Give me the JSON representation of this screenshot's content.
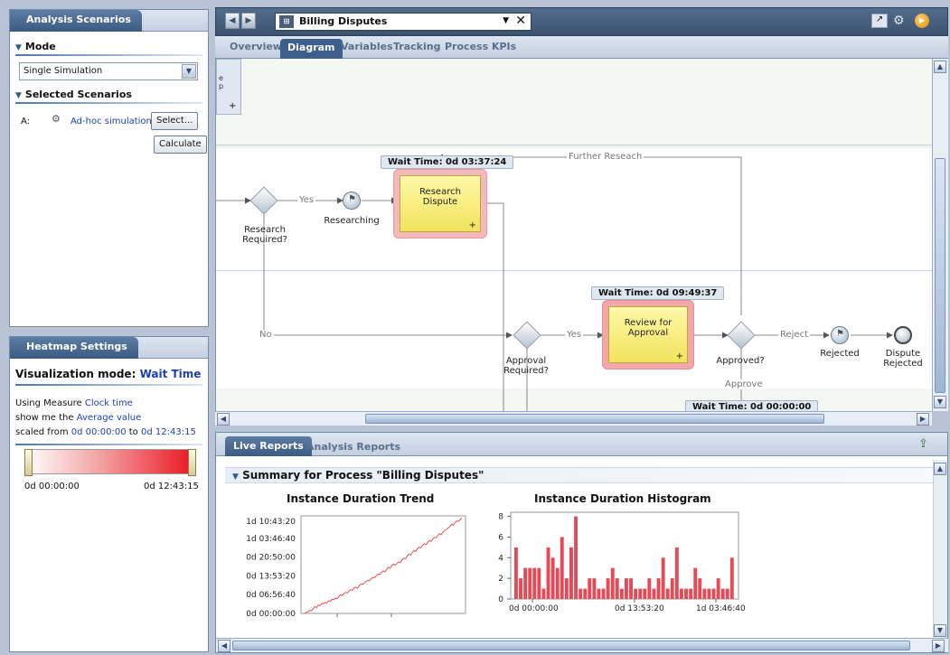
{
  "left_panel": {
    "tab_label": "Analysis Scenarios",
    "mode_title": "Mode",
    "mode_value": "Single Simulation",
    "selected_title": "Selected Scenarios",
    "scenario_letter": "A:",
    "scenario_name": "Ad-hoc simulation",
    "select_button": "Select...",
    "calculate_button": "Calculate"
  },
  "heatmap": {
    "tab_label": "Heatmap Settings",
    "mode_label": "Visualization mode:",
    "mode_value": "Wait Time",
    "measure_prefix": "Using Measure",
    "measure_value": "Clock time",
    "show_prefix": "show me the",
    "show_value": "Average value",
    "scaled_prefix": "scaled from",
    "scaled_from": "0d 00:00:00",
    "scaled_to_word": "to",
    "scaled_to": "0d 12:43:15",
    "legend_min": "0d 00:00:00",
    "legend_max": "0d 12:43:15",
    "colors": {
      "start": "#ffffff",
      "end": "#e8141f"
    }
  },
  "topbar": {
    "process_title": "Billing Disputes",
    "icons": [
      "chart-icon",
      "gear-icon",
      "play-icon"
    ]
  },
  "subtabs": [
    "Overview",
    "Diagram",
    "Variables",
    "Tracking",
    "Process KPIs"
  ],
  "diagram": {
    "wait_labels": [
      "Wait Time: 0d 03:37:24",
      "Wait Time: 0d 09:49:37",
      "Wait Time: 0d 00:00:00"
    ],
    "tasks": [
      "Research Dispute",
      "Review for Approval"
    ],
    "gateway_labels": [
      "Research Required?",
      "Approval Required?",
      "Approved?"
    ],
    "event_labels": [
      "Researching",
      "Rejected",
      "Dispute Rejected"
    ],
    "flow_labels": {
      "further": "Further Reseach",
      "yes1": "Yes",
      "yes2": "Yes",
      "no": "No",
      "reject": "Reject",
      "approve": "Approve"
    },
    "lane_stub": "e p",
    "lane_plus": "+"
  },
  "reports": {
    "tabs": [
      "Live Reports",
      "Analysis Reports"
    ],
    "summary_title": "Summary for Process \"Billing Disputes\""
  },
  "chart_data": [
    {
      "type": "line",
      "title": "Instance Duration Trend",
      "y_tick_labels": [
        "0d 00:00:00",
        "0d 06:56:40",
        "0d 13:53:20",
        "0d 20:50:00",
        "1d 03:46:40",
        "1d 10:43:20"
      ],
      "y_unit": "seconds",
      "ylim": [
        0,
        130000
      ],
      "values": [
        0,
        1400,
        2100,
        4200,
        3500,
        6300,
        9100,
        7700,
        11200,
        10500,
        13300,
        12600,
        14700,
        14000,
        16800,
        16100,
        18900,
        18200,
        20300,
        19600,
        22400,
        25200,
        23800,
        26600,
        28000,
        27300,
        30100,
        31500,
        30800,
        34300,
        35000,
        33600,
        37100,
        39200,
        38500,
        41300,
        42700,
        44100,
        43400,
        46200,
        48300,
        47600,
        50400,
        52500,
        51800,
        54600,
        56700,
        55300,
        58800,
        61600,
        60200,
        63700,
        65800,
        64400,
        66500,
        68600,
        67900,
        71400,
        73500,
        72800,
        76300,
        79100,
        77700,
        81200,
        84000,
        82600,
        86100,
        88200,
        87500,
        91000,
        93100,
        91700,
        94500,
        97300,
        95900,
        99400,
        101500,
        100800,
        104300,
        106400,
        105000,
        108500,
        110600,
        112000,
        114100,
        116200,
        119000,
        117600,
        121100,
        123200,
        122500,
        125300,
        126700
      ],
      "grid": false
    },
    {
      "type": "bar",
      "title": "Instance Duration Histogram",
      "x_tick_labels": [
        "0d 00:00:00",
        "0d 13:53:20",
        "1d 03:46:40"
      ],
      "y_ticks": [
        0,
        2,
        4,
        6,
        8
      ],
      "ylim": [
        0,
        8.4
      ],
      "values": [
        5,
        2,
        3,
        3,
        3,
        3,
        1,
        5,
        4,
        3,
        6,
        2,
        5,
        8,
        1,
        1,
        2,
        2,
        1,
        1,
        2,
        3,
        2,
        1,
        2,
        2,
        1,
        1,
        1,
        2,
        1,
        2,
        4,
        1,
        2,
        5,
        1,
        1,
        1,
        3,
        2,
        1,
        1,
        1,
        2,
        1,
        1,
        4
      ],
      "bar_color": "#e64a56",
      "grid": false
    }
  ]
}
